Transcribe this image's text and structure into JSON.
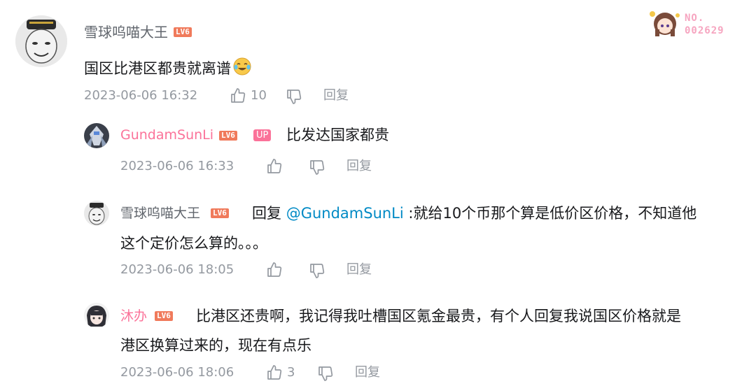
{
  "colors": {
    "pink": "#fb7299",
    "level_badge": "#f07a5b",
    "mention": "#008ac5",
    "meta_gray": "#9499a0"
  },
  "decoration": {
    "badge_label": "NO.",
    "badge_number": "002629"
  },
  "main_comment": {
    "username": "雪球呜喵大王",
    "level": "LV6",
    "text": "国区比港区都贵就离谱",
    "emoji": "emoji-laugh-cry",
    "timestamp": "2023-06-06 16:32",
    "likes": "10",
    "reply_label": "回复"
  },
  "replies": [
    {
      "username": "GundamSunLi",
      "level": "LV6",
      "up_badge": "UP",
      "text": "比发达国家都贵",
      "timestamp": "2023-06-06 16:33",
      "likes": "",
      "reply_label": "回复"
    },
    {
      "username": "雪球呜喵大王",
      "level": "LV6",
      "reply_prefix": "回复",
      "mention": "@GundamSunLi",
      "text_line1": ":就给10个币那个算是低价区价格，不知道他",
      "text_line2": "这个定价怎么算的。。。",
      "timestamp": "2023-06-06 18:05",
      "likes": "",
      "reply_label": "回复"
    },
    {
      "username": "沐办",
      "level": "LV6",
      "text_line1": "比港区还贵啊，我记得我吐槽国区氪金最贵，有个人回复我说国区价格就是",
      "text_line2": "港区换算过来的，现在有点乐",
      "timestamp": "2023-06-06 18:06",
      "likes": "3",
      "reply_label": "回复"
    }
  ]
}
